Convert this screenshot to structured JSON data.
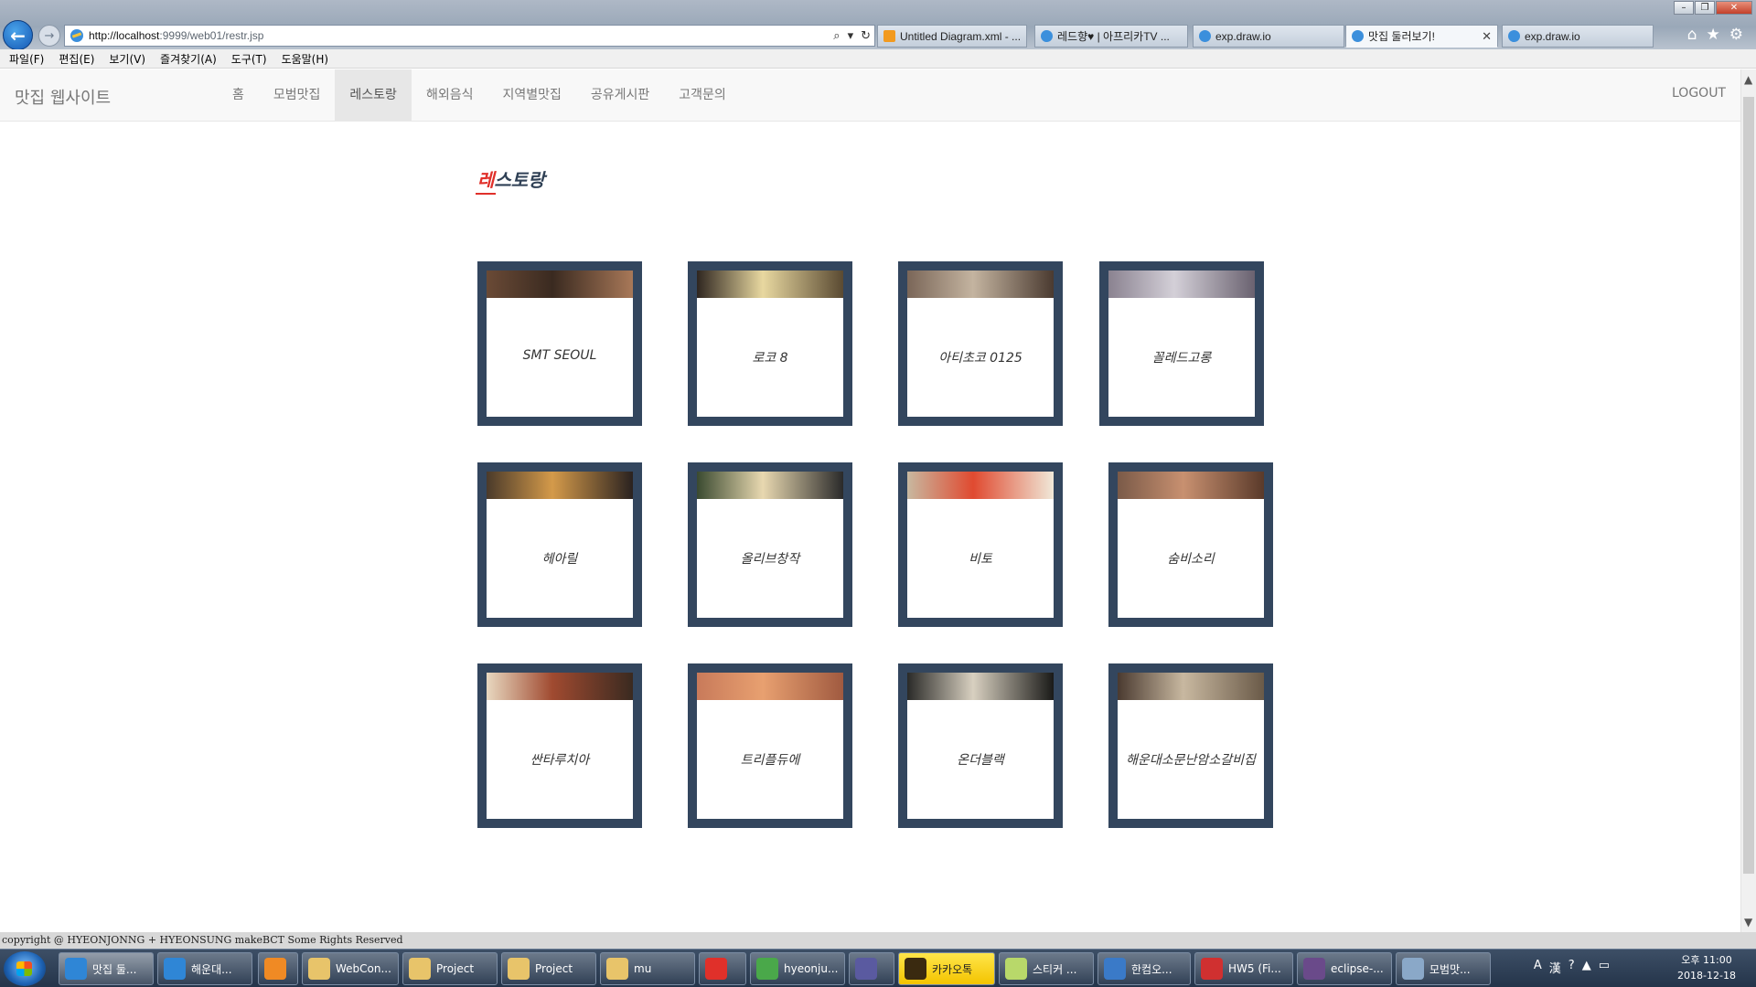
{
  "browser": {
    "url_host": "http://localhost",
    "url_rest": ":9999/web01/restr.jsp",
    "tabs": [
      {
        "label": "Untitled Diagram.xml - ...",
        "icon": "drawio-icon",
        "active": false
      },
      {
        "label": "레드향♥ | 아프리카TV ...",
        "icon": "ie-page-icon",
        "active": false
      },
      {
        "label": "exp.draw.io",
        "icon": "ie-page-icon",
        "active": false
      },
      {
        "label": "맛집 둘러보기!",
        "icon": "ie-page-icon",
        "active": true
      },
      {
        "label": "exp.draw.io",
        "icon": "ie-page-icon",
        "active": false
      }
    ],
    "menu": [
      "파일(F)",
      "편집(E)",
      "보기(V)",
      "즐겨찾기(A)",
      "도구(T)",
      "도움말(H)"
    ]
  },
  "site": {
    "brand": "맛집 웹사이트",
    "nav": [
      "홈",
      "모범맛집",
      "레스토랑",
      "해외음식",
      "지역별맛집",
      "공유게시판",
      "고객문의"
    ],
    "active_nav": "레스토랑",
    "logout": "LOGOUT"
  },
  "heading": {
    "first": "레",
    "rest": "스토랑"
  },
  "restaurants": [
    {
      "name": "SMT SEOUL",
      "photo": [
        "#6a4a36",
        "#3a2a20",
        "#a87858"
      ]
    },
    {
      "name": "로코 8",
      "photo": [
        "#2f2620",
        "#e8d8a0",
        "#5a4a32"
      ]
    },
    {
      "name": "아티초코 0125",
      "photo": [
        "#7a6658",
        "#c4b4a0",
        "#4a3a30"
      ]
    },
    {
      "name": "꼴레드고롱",
      "photo": [
        "#8a8290",
        "#d4d0d8",
        "#6a6270"
      ]
    },
    {
      "name": "헤아릴",
      "photo": [
        "#4a3a2a",
        "#d49a4a",
        "#2a2220"
      ]
    },
    {
      "name": "올리브창작",
      "photo": [
        "#3a4a30",
        "#e8d8b0",
        "#2a2a2a"
      ]
    },
    {
      "name": "비토",
      "photo": [
        "#c8b8a0",
        "#e04a30",
        "#f0e8d8"
      ]
    },
    {
      "name": "숨비소리",
      "photo": [
        "#7a5a48",
        "#c89070",
        "#5a3a2a"
      ]
    },
    {
      "name": "싼타루치아",
      "photo": [
        "#e8d8c0",
        "#a04a30",
        "#3a2a20"
      ]
    },
    {
      "name": "트리플듀에",
      "photo": [
        "#c87a5a",
        "#e8a070",
        "#a05a40"
      ]
    },
    {
      "name": "온더블랙",
      "photo": [
        "#2a2a28",
        "#d8d0c0",
        "#1a1a18"
      ]
    },
    {
      "name": "해운대소문난암소갈비집",
      "photo": [
        "#4a3a30",
        "#c8b8a0",
        "#6a5a48"
      ]
    }
  ],
  "footer": "copyright @ HYEONJONNG + HYEONSUNG makeBCT Some Rights Reserved",
  "taskbar": {
    "tasks": [
      {
        "label": "맛집 둘...",
        "icon_color": "#2f86d6",
        "style": "active"
      },
      {
        "label": "해운대...",
        "icon_color": "#2f86d6",
        "style": ""
      },
      {
        "label": "",
        "icon_color": "#f08a24",
        "style": ""
      },
      {
        "label": "WebCon...",
        "icon_color": "#e8c46a",
        "style": ""
      },
      {
        "label": "Project",
        "icon_color": "#e8c46a",
        "style": ""
      },
      {
        "label": "Project",
        "icon_color": "#e8c46a",
        "style": ""
      },
      {
        "label": "mu",
        "icon_color": "#e8c46a",
        "style": ""
      },
      {
        "label": "",
        "icon_color": "#e0302a",
        "style": ""
      },
      {
        "label": "hyeonju...",
        "icon_color": "#4aa84a",
        "style": ""
      },
      {
        "label": "",
        "icon_color": "#5a5aa0",
        "style": ""
      },
      {
        "label": "카카오톡",
        "icon_color": "#3a2a10",
        "style": "talk"
      },
      {
        "label": "스티커 ...",
        "icon_color": "#b8d86a",
        "style": ""
      },
      {
        "label": "한컴오...",
        "icon_color": "#3a7ac8",
        "style": ""
      },
      {
        "label": "HW5 (Fi...",
        "icon_color": "#d03030",
        "style": ""
      },
      {
        "label": "eclipse-...",
        "icon_color": "#6a4a8a",
        "style": ""
      },
      {
        "label": "모범맛...",
        "icon_color": "#8aa8c8",
        "style": ""
      }
    ],
    "tray": [
      "A",
      "漢",
      "?"
    ],
    "clock_time": "오후 11:00",
    "clock_date": "2018-12-18"
  }
}
